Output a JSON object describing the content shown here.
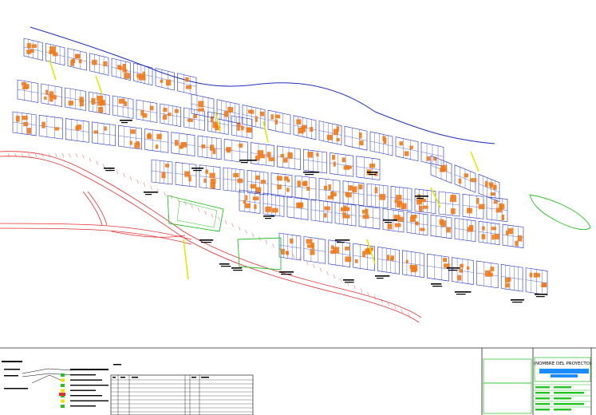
{
  "colors": {
    "background": "#ffffff",
    "boundary": "#1f2fbf",
    "blocks": "#1f2fbf",
    "lots": "#f07a1a",
    "roads": "#e23030",
    "parks": "#22c322",
    "accent": "#e6e600",
    "annotations": "#000000",
    "title_fill": "#1a8cff"
  },
  "title_block": {
    "project_name": "(NOMBRE DEL PROYECTO)"
  }
}
